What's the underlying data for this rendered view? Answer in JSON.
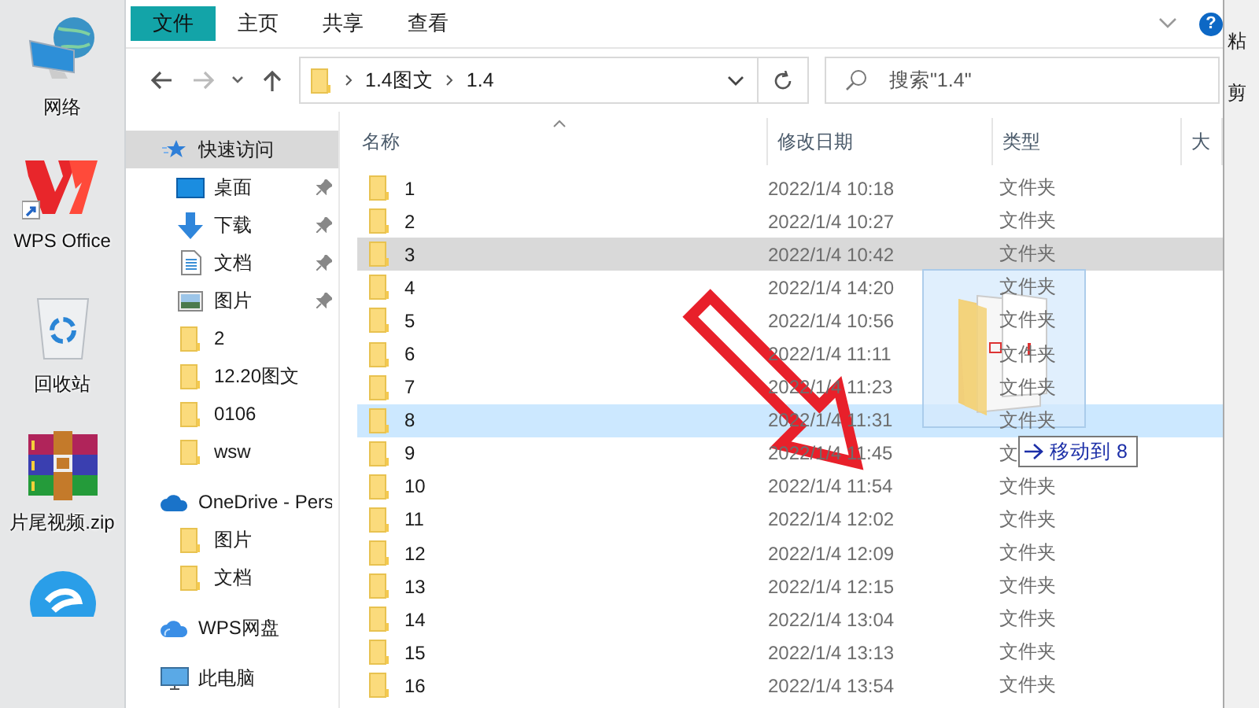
{
  "desktop": {
    "icons": [
      {
        "kind": "network",
        "label": "网络"
      },
      {
        "kind": "wps",
        "label": "WPS Office"
      },
      {
        "kind": "recycle-bin",
        "label": "回收站"
      },
      {
        "kind": "archive",
        "label": "片尾视频.zip"
      },
      {
        "kind": "blue-app"
      }
    ]
  },
  "explorer": {
    "ribbon_tabs": [
      {
        "label": "文件",
        "selected": true
      },
      {
        "label": "主页",
        "selected": false
      },
      {
        "label": "共享",
        "selected": false
      },
      {
        "label": "查看",
        "selected": false
      }
    ],
    "help_glyph": "?",
    "address_bar": {
      "path": [
        "1.4图文",
        "1.4"
      ]
    },
    "search": {
      "placeholder": "搜索\"1.4\""
    },
    "nav_pane": {
      "items": [
        {
          "kind": "quick-access",
          "label": "快速访问",
          "selected": true,
          "children": [
            {
              "kind": "desktop",
              "label": "桌面",
              "selected": false,
              "pinned": true
            },
            {
              "kind": "download",
              "label": "下载",
              "selected": false,
              "pinned": true
            },
            {
              "kind": "documents",
              "label": "文档",
              "selected": false,
              "pinned": true
            },
            {
              "kind": "pictures",
              "label": "图片",
              "selected": false,
              "pinned": true
            },
            {
              "kind": "folder",
              "label": "2",
              "selected": false,
              "pinned": false
            },
            {
              "kind": "folder",
              "label": "12.20图文",
              "selected": false,
              "pinned": false
            },
            {
              "kind": "folder",
              "label": "0106",
              "selected": false,
              "pinned": false
            },
            {
              "kind": "folder",
              "label": "wsw",
              "selected": false,
              "pinned": false
            }
          ]
        },
        {
          "kind": "onedrive",
          "label": "OneDrive - Pers",
          "selected": false,
          "children": [
            {
              "kind": "folder",
              "label": "图片",
              "selected": false,
              "pinned": false
            },
            {
              "kind": "folder",
              "label": "文档",
              "selected": false,
              "pinned": false
            }
          ]
        },
        {
          "kind": "wps-cloud",
          "label": "WPS网盘",
          "selected": false
        },
        {
          "kind": "this-pc",
          "label": "此电脑",
          "selected": false
        }
      ]
    },
    "files": {
      "columns": [
        "名称",
        "修改日期",
        "类型",
        "大"
      ],
      "rows": [
        {
          "name": "1",
          "modified": "2022/1/4 10:18",
          "type": "文件夹",
          "selected": false,
          "drop_target": false
        },
        {
          "name": "2",
          "modified": "2022/1/4 10:27",
          "type": "文件夹",
          "selected": false,
          "drop_target": false
        },
        {
          "name": "3",
          "modified": "2022/1/4 10:42",
          "type": "文件夹",
          "selected": true,
          "drop_target": false
        },
        {
          "name": "4",
          "modified": "2022/1/4 14:20",
          "type": "文件夹",
          "selected": false,
          "drop_target": false
        },
        {
          "name": "5",
          "modified": "2022/1/4 10:56",
          "type": "文件夹",
          "selected": false,
          "drop_target": false
        },
        {
          "name": "6",
          "modified": "2022/1/4 11:11",
          "type": "文件夹",
          "selected": false,
          "drop_target": false
        },
        {
          "name": "7",
          "modified": "2022/1/4 11:23",
          "type": "文件夹",
          "selected": false,
          "drop_target": false
        },
        {
          "name": "8",
          "modified": "2022/1/4 11:31",
          "type": "文件夹",
          "selected": false,
          "drop_target": true
        },
        {
          "name": "9",
          "modified": "2022/1/4 11:45",
          "type": "文",
          "selected": false,
          "drop_target": false
        },
        {
          "name": "10",
          "modified": "2022/1/4 11:54",
          "type": "文件夹",
          "selected": false,
          "drop_target": false
        },
        {
          "name": "11",
          "modified": "2022/1/4 12:02",
          "type": "文件夹",
          "selected": false,
          "drop_target": false
        },
        {
          "name": "12",
          "modified": "2022/1/4 12:09",
          "type": "文件夹",
          "selected": false,
          "drop_target": false
        },
        {
          "name": "13",
          "modified": "2022/1/4 12:15",
          "type": "文件夹",
          "selected": false,
          "drop_target": false
        },
        {
          "name": "14",
          "modified": "2022/1/4 13:04",
          "type": "文件夹",
          "selected": false,
          "drop_target": false
        },
        {
          "name": "15",
          "modified": "2022/1/4 13:13",
          "type": "文件夹",
          "selected": false,
          "drop_target": false
        },
        {
          "name": "16",
          "modified": "2022/1/4 13:54",
          "type": "文件夹",
          "selected": false,
          "drop_target": false
        }
      ]
    },
    "drag_tooltip": "移动到 8"
  },
  "side_window": {
    "texts": [
      "粘",
      "剪"
    ]
  }
}
